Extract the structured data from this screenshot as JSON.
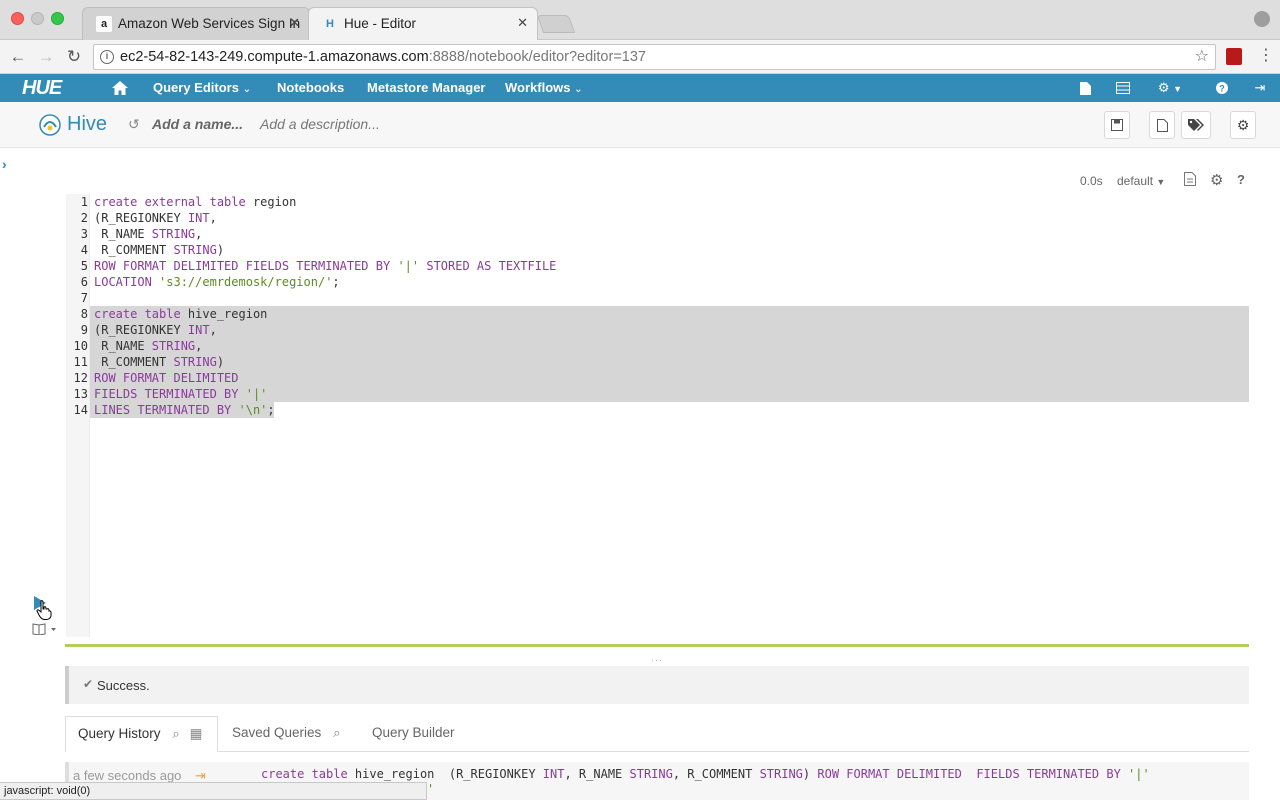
{
  "browser": {
    "tabs": [
      {
        "title": "Amazon Web Services Sign In",
        "favicon": "a"
      },
      {
        "title": "Hue - Editor",
        "favicon": "H"
      }
    ],
    "url_host": "ec2-54-82-143-249.compute-1.amazonaws.com",
    "url_rest": ":8888/notebook/editor?editor=137",
    "status_text": "javascript: void(0)"
  },
  "hue_nav": {
    "logo": "HUE",
    "items": [
      "Query Editors",
      "Notebooks",
      "Metastore Manager",
      "Workflows"
    ]
  },
  "editor_header": {
    "title": "Hive",
    "name_placeholder": "Add a name...",
    "description_placeholder": "Add a description..."
  },
  "snippet": {
    "duration": "0.0s",
    "database": "default"
  },
  "code_lines": [
    [
      {
        "t": "create external table",
        "c": "kw"
      },
      {
        "t": " region",
        "c": ""
      }
    ],
    [
      {
        "t": "(R_REGIONKEY ",
        "c": ""
      },
      {
        "t": "INT",
        "c": "kw"
      },
      {
        "t": ",",
        "c": ""
      }
    ],
    [
      {
        "t": " R_NAME ",
        "c": ""
      },
      {
        "t": "STRING",
        "c": "kw"
      },
      {
        "t": ",",
        "c": ""
      }
    ],
    [
      {
        "t": " R_COMMENT ",
        "c": ""
      },
      {
        "t": "STRING",
        "c": "kw"
      },
      {
        "t": ")",
        "c": ""
      }
    ],
    [
      {
        "t": "ROW FORMAT DELIMITED FIELDS TERMINATED BY ",
        "c": "kw"
      },
      {
        "t": "'|'",
        "c": "str"
      },
      {
        "t": " STORED AS TEXTFILE",
        "c": "kw"
      }
    ],
    [
      {
        "t": "LOCATION ",
        "c": "kw"
      },
      {
        "t": "'s3://emrdemosk/region/'",
        "c": "str"
      },
      {
        "t": ";",
        "c": ""
      }
    ],
    [],
    [
      {
        "t": "create table",
        "c": "kw"
      },
      {
        "t": " hive_region",
        "c": ""
      }
    ],
    [
      {
        "t": "(R_REGIONKEY ",
        "c": ""
      },
      {
        "t": "INT",
        "c": "kw"
      },
      {
        "t": ",",
        "c": ""
      }
    ],
    [
      {
        "t": " R_NAME ",
        "c": ""
      },
      {
        "t": "STRING",
        "c": "kw"
      },
      {
        "t": ",",
        "c": ""
      }
    ],
    [
      {
        "t": " R_COMMENT ",
        "c": ""
      },
      {
        "t": "STRING",
        "c": "kw"
      },
      {
        "t": ")",
        "c": ""
      }
    ],
    [
      {
        "t": "ROW FORMAT DELIMITED",
        "c": "kw"
      }
    ],
    [
      {
        "t": "FIELDS TERMINATED BY ",
        "c": "kw"
      },
      {
        "t": "'|'",
        "c": "str"
      }
    ],
    [
      {
        "t": "LINES TERMINATED BY ",
        "c": "kw"
      },
      {
        "t": "'\\n'",
        "c": "str"
      },
      {
        "t": ";",
        "c": ""
      }
    ]
  ],
  "result": {
    "message": "Success."
  },
  "query_tabs": [
    "Query History",
    "Saved Queries",
    "Query Builder"
  ],
  "history": {
    "when": "a few seconds ago",
    "query": [
      {
        "t": "create table",
        "c": "kw"
      },
      {
        "t": " hive_region  (R_REGIONKEY ",
        "c": ""
      },
      {
        "t": "INT",
        "c": "kw"
      },
      {
        "t": ", R_NAME ",
        "c": ""
      },
      {
        "t": "STRING",
        "c": "kw"
      },
      {
        "t": ", R_COMMENT ",
        "c": ""
      },
      {
        "t": "STRING",
        "c": "kw"
      },
      {
        "t": ") ",
        "c": ""
      },
      {
        "t": "ROW FORMAT DELIMITED  FIELDS TERMINATED BY ",
        "c": "kw"
      },
      {
        "t": "'|'",
        "c": "str"
      }
    ],
    "query_cont": "'"
  },
  "colors": {
    "hue_blue": "#338bb8",
    "success_green": "#b2cc5f",
    "keyword": "#8a3b9a",
    "string": "#5e8b23"
  }
}
